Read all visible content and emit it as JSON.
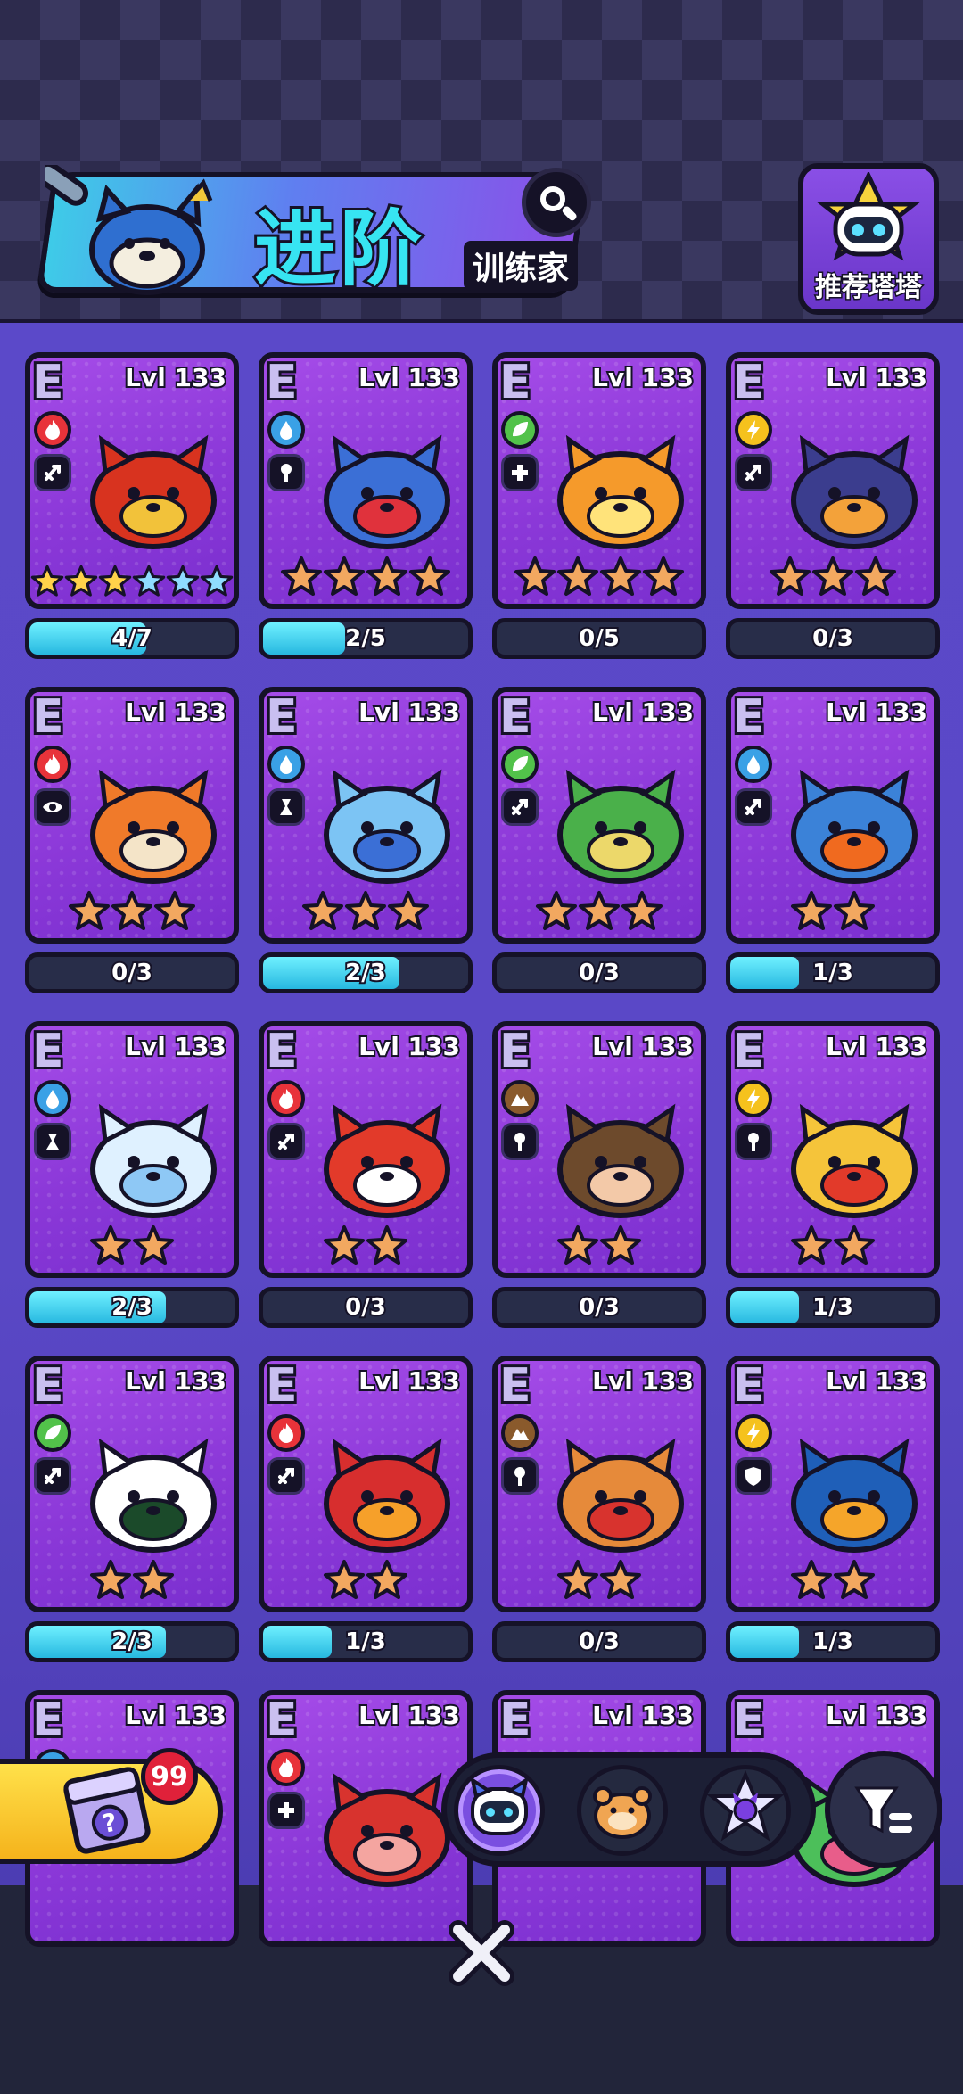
{
  "header": {
    "title": "进阶",
    "subtitle": "训练家",
    "recommend_label": "推荐塔塔"
  },
  "cards": [
    {
      "grade": "E",
      "level": "Lvl 133",
      "element": "fire",
      "role": "attack",
      "stars": 6,
      "progress": "4/7",
      "fill": 0.571,
      "creature": "phoenix-rooster"
    },
    {
      "grade": "E",
      "level": "Lvl 133",
      "element": "water",
      "role": "mage",
      "stars": 4,
      "progress": "2/5",
      "fill": 0.4,
      "creature": "crab"
    },
    {
      "grade": "E",
      "level": "Lvl 133",
      "element": "grass",
      "role": "healer",
      "stars": 4,
      "progress": "0/5",
      "fill": 0,
      "creature": "sunflower"
    },
    {
      "grade": "E",
      "level": "Lvl 133",
      "element": "electric",
      "role": "attack",
      "stars": 3,
      "progress": "0/3",
      "fill": 0,
      "creature": "rhino"
    },
    {
      "grade": "E",
      "level": "Lvl 133",
      "element": "fire",
      "role": "scout",
      "stars": 3,
      "progress": "0/3",
      "fill": 0,
      "creature": "tiger"
    },
    {
      "grade": "E",
      "level": "Lvl 133",
      "element": "water",
      "role": "support",
      "stars": 3,
      "progress": "2/3",
      "fill": 0.667,
      "creature": "blue-fish-cat"
    },
    {
      "grade": "E",
      "level": "Lvl 133",
      "element": "grass",
      "role": "attack",
      "stars": 3,
      "progress": "0/3",
      "fill": 0,
      "creature": "leaf-bird"
    },
    {
      "grade": "E",
      "level": "Lvl 133",
      "element": "water",
      "role": "attack",
      "stars": 2,
      "progress": "1/3",
      "fill": 0.333,
      "creature": "pumpkin-cat"
    },
    {
      "grade": "E",
      "level": "Lvl 133",
      "element": "water",
      "role": "support",
      "stars": 2,
      "progress": "2/3",
      "fill": 0.667,
      "creature": "cloud-bunny"
    },
    {
      "grade": "E",
      "level": "Lvl 133",
      "element": "fire",
      "role": "attack",
      "stars": 2,
      "progress": "0/3",
      "fill": 0,
      "creature": "red-fox"
    },
    {
      "grade": "E",
      "level": "Lvl 133",
      "element": "earth",
      "role": "mage",
      "stars": 2,
      "progress": "0/3",
      "fill": 0,
      "creature": "monkey"
    },
    {
      "grade": "E",
      "level": "Lvl 133",
      "element": "electric",
      "role": "mage",
      "stars": 2,
      "progress": "1/3",
      "fill": 0.333,
      "creature": "yellow-fox"
    },
    {
      "grade": "E",
      "level": "Lvl 133",
      "element": "grass",
      "role": "attack",
      "stars": 2,
      "progress": "2/3",
      "fill": 0.667,
      "creature": "panda"
    },
    {
      "grade": "E",
      "level": "Lvl 133",
      "element": "fire",
      "role": "attack",
      "stars": 2,
      "progress": "1/3",
      "fill": 0.333,
      "creature": "boxing-bird"
    },
    {
      "grade": "E",
      "level": "Lvl 133",
      "element": "earth",
      "role": "mage",
      "stars": 2,
      "progress": "0/3",
      "fill": 0,
      "creature": "kangaroo"
    },
    {
      "grade": "E",
      "level": "Lvl 133",
      "element": "electric",
      "role": "defense",
      "stars": 2,
      "progress": "1/3",
      "fill": 0.333,
      "creature": "toucan"
    },
    {
      "grade": "E",
      "level": "Lvl 133",
      "element": "water",
      "role": "none",
      "stars": 0,
      "progress": "",
      "fill": 0,
      "creature": "hidden"
    },
    {
      "grade": "E",
      "level": "Lvl 133",
      "element": "fire",
      "role": "healer",
      "stars": 0,
      "progress": "",
      "fill": 0,
      "creature": "pepper-pig"
    },
    {
      "grade": "E",
      "level": "Lvl 133",
      "element": "none",
      "role": "none",
      "stars": 0,
      "progress": "",
      "fill": 0,
      "creature": "hidden"
    },
    {
      "grade": "E",
      "level": "Lvl 133",
      "element": "none",
      "role": "none",
      "stars": 0,
      "progress": "",
      "fill": 0,
      "creature": "frog"
    }
  ],
  "gift": {
    "count": "99"
  },
  "tabs": [
    "robot-cat-tab",
    "hamster-tab",
    "star-cat-tab"
  ],
  "colors": {
    "fire": "#e8333a",
    "water": "#3aa1e6",
    "grass": "#52c24a",
    "electric": "#f5c21d",
    "earth": "#8a5a2c",
    "accent": "#37e4f2"
  }
}
